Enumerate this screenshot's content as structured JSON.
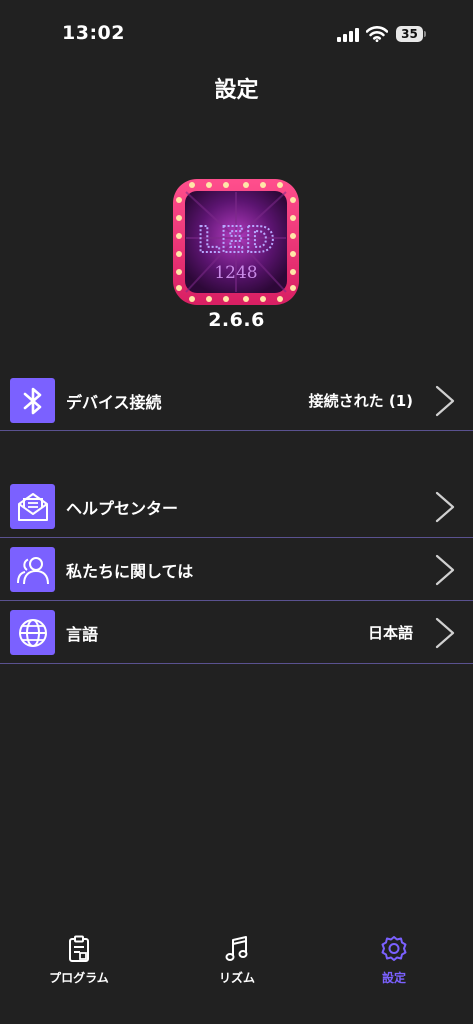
{
  "status_bar": {
    "time": "13:02",
    "battery": "35"
  },
  "header": {
    "title": "設定"
  },
  "app": {
    "logo_text": "LED",
    "logo_subtext": "1248",
    "version": "2.6.6"
  },
  "settings": [
    {
      "label": "デバイス接続",
      "value": "接続された (1)",
      "icon": "bluetooth-icon"
    },
    {
      "label": "ヘルプセンター",
      "value": "",
      "icon": "mail-icon"
    },
    {
      "label": "私たちに関しては",
      "value": "",
      "icon": "users-icon"
    },
    {
      "label": "言語",
      "value": "日本語",
      "icon": "globe-icon"
    }
  ],
  "tabs": [
    {
      "label": "プログラム",
      "icon": "clipboard-icon",
      "active": false
    },
    {
      "label": "リズム",
      "icon": "music-note-icon",
      "active": false
    },
    {
      "label": "設定",
      "icon": "gear-icon",
      "active": true
    }
  ],
  "colors": {
    "accent": "#7B61FF",
    "background": "#212121",
    "divider": "#5a5290",
    "logo_frame": "#E8306E"
  }
}
